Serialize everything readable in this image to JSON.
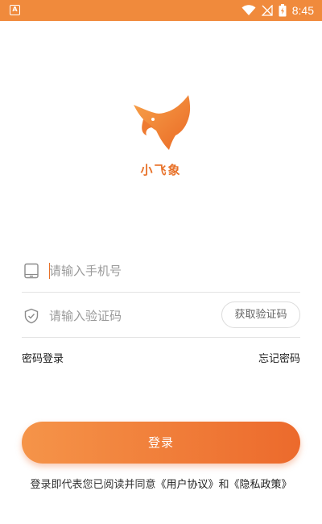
{
  "status_bar": {
    "app_icon_letter": "A",
    "time": "8:45",
    "icons": [
      "wifi-icon",
      "signal-icon",
      "battery-icon"
    ]
  },
  "app": {
    "name": "小飞象",
    "logo_icon": "elephant-logo-icon",
    "brand_color": "#f08a3c"
  },
  "form": {
    "phone": {
      "icon": "phone-icon",
      "placeholder": "请输入手机号",
      "value": ""
    },
    "code": {
      "icon": "shield-check-icon",
      "placeholder": "请输入验证码",
      "value": "",
      "get_code_label": "获取验证码"
    },
    "password_login_label": "密码登录",
    "forgot_password_label": "忘记密码",
    "login_label": "登录"
  },
  "agreement": {
    "prefix": "登录即代表您已阅读并同意",
    "user_agreement": "《用户协议》",
    "and": "和",
    "privacy_policy": "《隐私政策》"
  }
}
